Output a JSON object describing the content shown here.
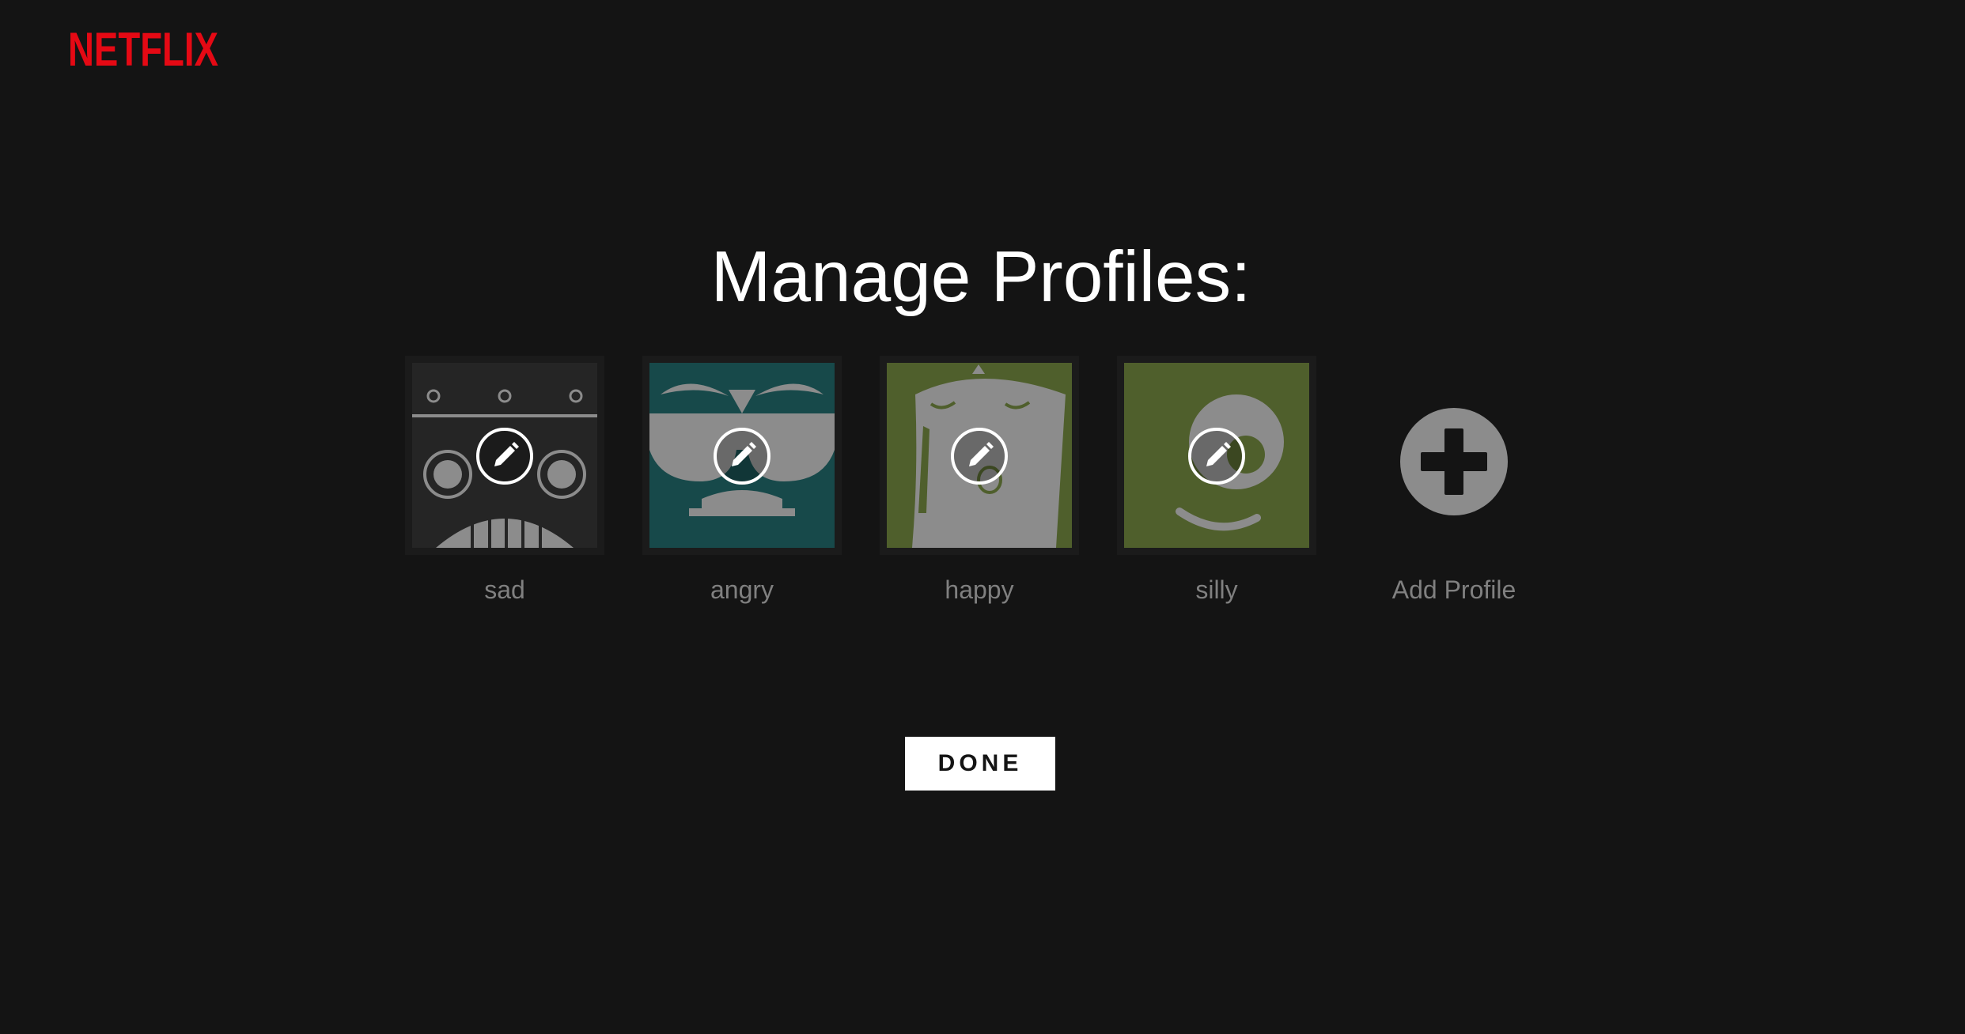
{
  "brand": {
    "logo_text": "NETFLIX",
    "color": "#e50914"
  },
  "page": {
    "title": "Manage Profiles:"
  },
  "profiles": [
    {
      "name": "sad",
      "avatar_color": "#252525",
      "avatar_icon": "robot-face-icon"
    },
    {
      "name": "angry",
      "avatar_color": "#17494a",
      "avatar_icon": "sunglasses-face-icon"
    },
    {
      "name": "happy",
      "avatar_color": "#4f5f2c",
      "avatar_icon": "happy-face-icon"
    },
    {
      "name": "silly",
      "avatar_color": "#4f5f2c",
      "avatar_icon": "silly-face-icon"
    }
  ],
  "add_profile": {
    "label": "Add Profile",
    "icon": "plus-circle-icon"
  },
  "actions": {
    "done_label": "DONE"
  },
  "colors": {
    "background": "#141414",
    "avatar_art": "#8c8c8c",
    "profile_label": "#808080",
    "button_bg": "#ffffff"
  }
}
